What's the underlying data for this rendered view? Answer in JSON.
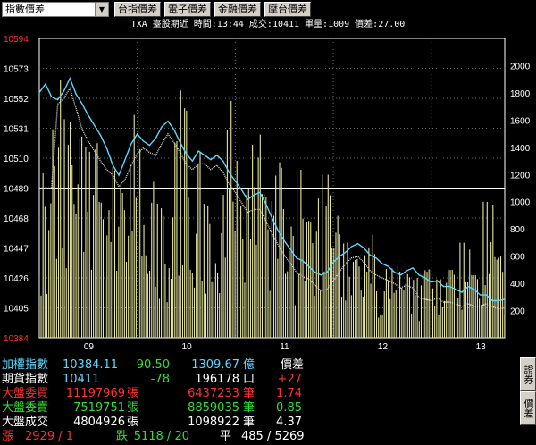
{
  "toolbar": {
    "selector_value": "指數價差",
    "buttons": [
      "台指價差",
      "電子價差",
      "金融價差",
      "摩台價差"
    ]
  },
  "info_line": "TXA  臺股期近 時間:13:44 成交:10411 單量:1009 價差:27.00",
  "colors": {
    "background": "#000000",
    "price_line": "#5fd7ff",
    "volume": "#e6e6a0",
    "axis": "#ffffff",
    "grid": "#6a6a6a",
    "up": "#ff3030",
    "down": "#30e030",
    "neutral": "#ffffff"
  },
  "chart_data": {
    "type": "line",
    "title": "",
    "y_price_ticks": [
      "10594",
      "10573",
      "10552",
      "10531",
      "10510",
      "10489",
      "10468",
      "10447",
      "10426",
      "10405",
      "10384"
    ],
    "ylim_price": [
      10384,
      10594
    ],
    "reference_price": 10489,
    "y_volume_ticks": [
      "2000",
      "1800",
      "1600",
      "1400",
      "1200",
      "1000",
      "800",
      "600",
      "400",
      "200"
    ],
    "ylim_volume": [
      0,
      2200
    ],
    "x_ticks": [
      "09",
      "10",
      "11",
      "12",
      "13"
    ],
    "x_minutes": [
      0,
      60,
      120,
      180,
      240,
      285
    ],
    "futures_series": [
      10556,
      10562,
      10553,
      10551,
      10557,
      10566,
      10555,
      10548,
      10540,
      10533,
      10526,
      10517,
      10505,
      10498,
      10509,
      10520,
      10527,
      10522,
      10519,
      10524,
      10532,
      10536,
      10530,
      10521,
      10513,
      10508,
      10515,
      10512,
      10509,
      10512,
      10508,
      10500,
      10494,
      10488,
      10481,
      10484,
      10486,
      10478,
      10468,
      10459,
      10452,
      10446,
      10440,
      10438,
      10434,
      10430,
      10428,
      10430,
      10437,
      10441,
      10444,
      10448,
      10450,
      10447,
      10442,
      10440,
      10436,
      10434,
      10430,
      10428,
      10431,
      10433,
      10428,
      10426,
      10423,
      10424,
      10420,
      10420,
      10418,
      10416,
      10420,
      10418,
      10414,
      10414,
      10410,
      10410,
      10411
    ],
    "index_series": [
      10489,
      10489,
      10489,
      10548,
      10552,
      10559,
      10545,
      10530,
      10522,
      10515,
      10508,
      10502,
      10498,
      10490,
      10495,
      10505,
      10513,
      10517,
      10514,
      10512,
      10520,
      10527,
      10521,
      10514,
      10506,
      10502,
      10506,
      10506,
      10502,
      10505,
      10500,
      10492,
      10486,
      10479,
      10472,
      10474,
      10474,
      10466,
      10457,
      10449,
      10442,
      10436,
      10430,
      10427,
      10425,
      10421,
      10417,
      10418,
      10424,
      10430,
      10436,
      10440,
      10441,
      10437,
      10431,
      10428,
      10426,
      10424,
      10422,
      10419,
      10421,
      10419,
      10412,
      10411,
      10410,
      10412,
      10409,
      10409,
      10408,
      10406,
      10408,
      10406,
      10406,
      10408,
      10406,
      10404,
      10405
    ],
    "volume_peaks": [
      1240,
      1910,
      1620,
      1550,
      1430,
      1000,
      1400,
      1290,
      1870,
      1180,
      1000,
      1560,
      1820,
      1430,
      1000,
      1050,
      1760,
      1210,
      1500,
      1060,
      1340,
      840,
      1240,
      1040,
      1200,
      900,
      700,
      620,
      760,
      520,
      530,
      480,
      470,
      510,
      430,
      500,
      700,
      460,
      1000,
      600
    ],
    "xlabel": "",
    "ylabel": ""
  },
  "quotes": {
    "row1": {
      "label": "加權指數",
      "value": "10384.11",
      "change": "-90.50",
      "amount": "1309.67",
      "unit": "億",
      "right_label": "價差"
    },
    "row2": {
      "label": "期貨指數",
      "value": "10411",
      "change": "-78",
      "amount": "196178",
      "unit": "口",
      "right_value": "+27"
    },
    "row3": {
      "label": "大盤委買",
      "value": "11197969",
      "unit1": "張",
      "amount": "6437233",
      "unit": "筆",
      "right_value": "1.74"
    },
    "row4": {
      "label": "大盤委賣",
      "value": "7519751",
      "unit1": "張",
      "amount": "8859035",
      "unit": "筆",
      "right_value": "0.85"
    },
    "row5": {
      "label": "大盤成交",
      "value": "4804926",
      "unit1": "張",
      "amount": "1098922",
      "unit": "筆",
      "right_value": "4.37"
    },
    "row6": {
      "up_label": "漲",
      "up_value": "2929 / 1",
      "down_label": "跌",
      "down_value": "5118 / 20",
      "flat_label": "平",
      "flat_value": "485 / 5269"
    }
  },
  "side_tabs": [
    "證券",
    "價差"
  ]
}
